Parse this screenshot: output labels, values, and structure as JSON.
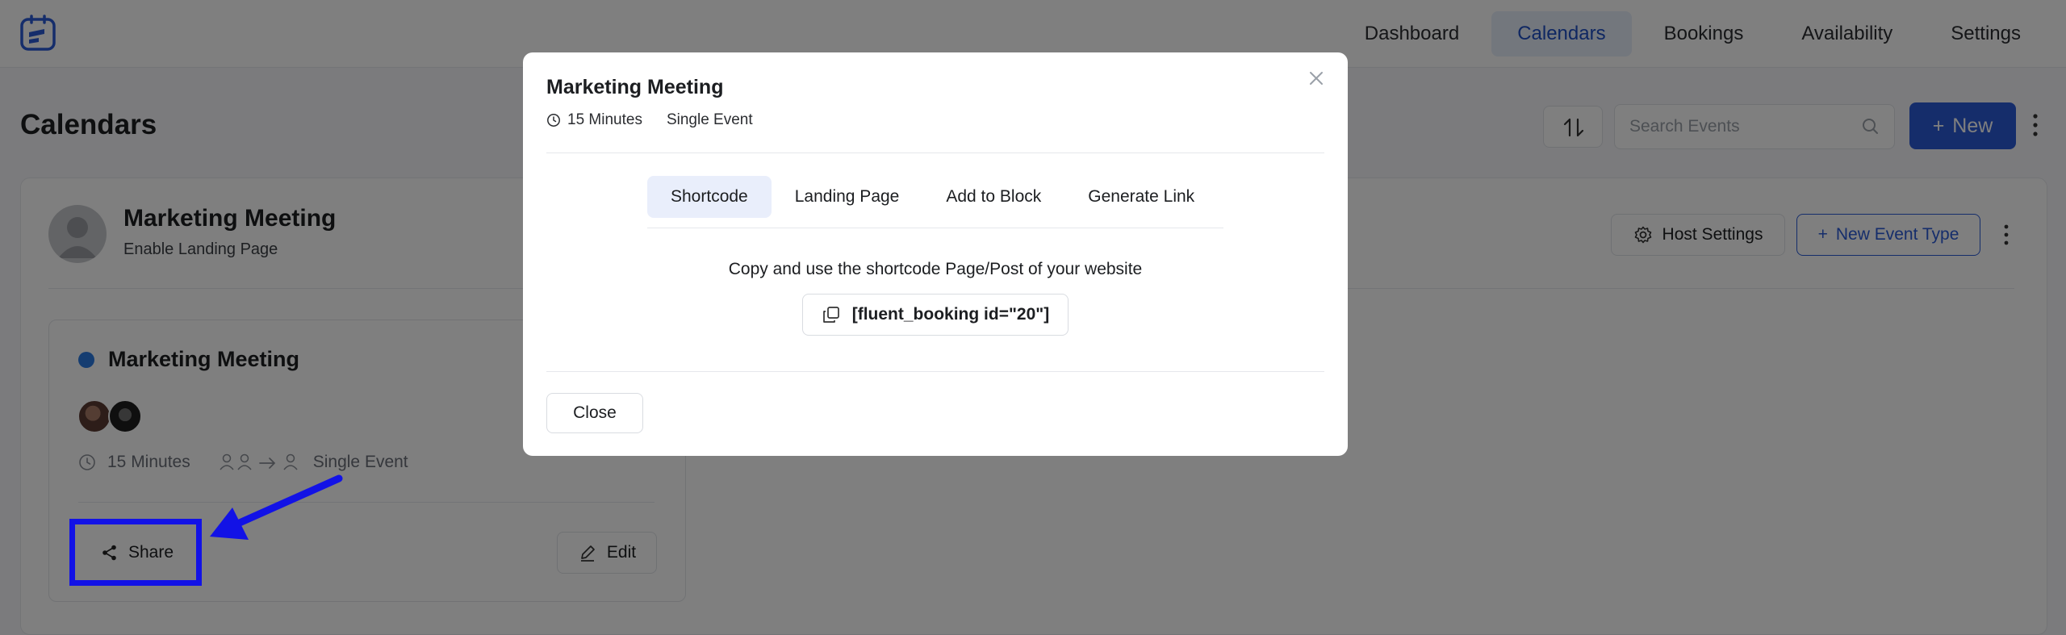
{
  "nav": {
    "logo_icon": "fluent-booking-logo",
    "links": [
      {
        "label": "Dashboard",
        "active": false
      },
      {
        "label": "Calendars",
        "active": true
      },
      {
        "label": "Bookings",
        "active": false
      },
      {
        "label": "Availability",
        "active": false
      },
      {
        "label": "Settings",
        "active": false
      }
    ]
  },
  "page": {
    "title": "Calendars",
    "search_placeholder": "Search Events",
    "new_button": "New",
    "new_button_prefix": "+"
  },
  "host": {
    "name": "Marketing Meeting",
    "subtitle": "Enable Landing Page",
    "host_settings_label": "Host Settings",
    "new_event_type_label": "New Event Type",
    "new_event_type_prefix": "+"
  },
  "event": {
    "title": "Marketing Meeting",
    "duration": "15 Minutes",
    "type": "Single Event",
    "share_label": "Share",
    "edit_label": "Edit",
    "dot_color": "#2a7ae2"
  },
  "modal": {
    "title": "Marketing Meeting",
    "duration": "15 Minutes",
    "type": "Single Event",
    "tabs": [
      {
        "label": "Shortcode",
        "active": true
      },
      {
        "label": "Landing Page",
        "active": false
      },
      {
        "label": "Add to Block",
        "active": false
      },
      {
        "label": "Generate Link",
        "active": false
      }
    ],
    "instruction": "Copy and use the shortcode Page/Post of your website",
    "shortcode": "[fluent_booking id=\"20\"]",
    "close_label": "Close"
  },
  "colors": {
    "accent": "#2a5bd7",
    "annotation": "#1212e6"
  }
}
